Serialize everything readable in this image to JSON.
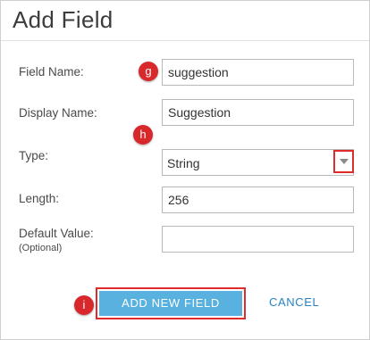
{
  "dialog": {
    "title": "Add Field"
  },
  "fields": {
    "field_name": {
      "label": "Field Name:",
      "value": "suggestion"
    },
    "display_name": {
      "label": "Display Name:",
      "value": "Suggestion"
    },
    "type": {
      "label": "Type:",
      "value": "String"
    },
    "length": {
      "label": "Length:",
      "value": "256"
    },
    "default_value": {
      "label": "Default Value:",
      "sublabel": "(Optional)",
      "value": ""
    }
  },
  "markers": {
    "g": "g",
    "h": "h",
    "i": "i"
  },
  "buttons": {
    "add_label": "ADD NEW FIELD",
    "cancel_label": "CANCEL"
  },
  "colors": {
    "primary_button": "#58b1de",
    "link": "#2a83c3",
    "highlight": "#e02b2b",
    "marker": "#d9282b"
  }
}
